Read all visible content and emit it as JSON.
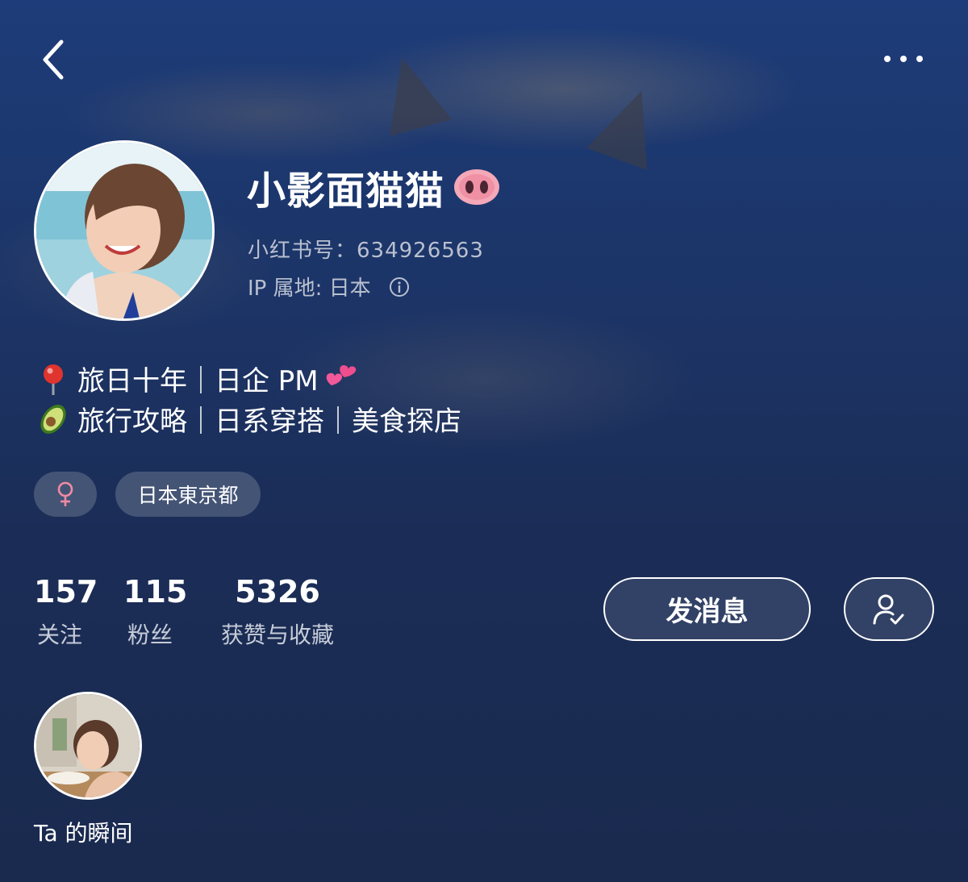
{
  "profile": {
    "nickname": "小影面猫猫",
    "red_id": "小红书号：634926563",
    "ip_location": "IP 属地: 日本",
    "bio_line1": "旅日十年｜日企 PM",
    "bio_line2": "旅行攻略｜日系穿搭｜美食探店",
    "location_tag": "日本東京都"
  },
  "stats": [
    {
      "value": "157",
      "label": "关注"
    },
    {
      "value": "115",
      "label": "粉丝"
    },
    {
      "value": "5326",
      "label": "获赞与收藏"
    }
  ],
  "actions": {
    "message_label": "发消息"
  },
  "moments": {
    "label": "Ta 的瞬间"
  },
  "icons": {
    "back": "chevron-left-icon",
    "more": "more-dots-icon",
    "nickname_emoji": "pig-nose-emoji",
    "info": "info-circle-icon",
    "bio_emoji1": "round-pushpin-emoji",
    "bio_emoji2": "avocado-emoji",
    "bio_emoji3": "two-hearts-emoji",
    "gender": "female-sign-icon",
    "followed": "user-check-icon"
  },
  "colors": {
    "female_pink": "#f08aa5",
    "secondary_text": "#b9c0cf"
  }
}
